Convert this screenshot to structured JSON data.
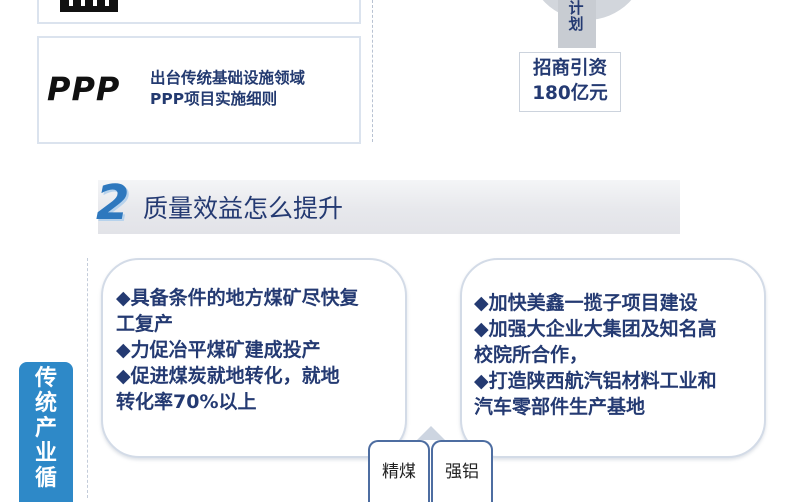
{
  "policy": {
    "ppp_logo": "PPP",
    "ppp_line1": "出台传统基础设施领域",
    "ppp_line2": "PPP项目实施细则"
  },
  "investment": {
    "plan_label": "计划",
    "title_line1": "招商引资",
    "title_line2": "180亿元"
  },
  "section": {
    "number": "2",
    "title": "质量效益怎么提升"
  },
  "side_label": "传统产业循",
  "left_card": {
    "lines": [
      "◆具备条件的地方煤矿尽快复",
      "工复产",
      "◆力促冶平煤矿建成投产",
      "◆促进煤炭就地转化，就地",
      "转化率70%以上"
    ]
  },
  "right_card": {
    "lines": [
      "◆加快美鑫一揽子项目建设",
      "◆加强大企业大集团及知名高",
      "校院所合作，",
      "◆打造陕西航汽铝材料工业和",
      "汽车零部件生产基地"
    ]
  },
  "bottom_labels": [
    "精煤",
    "强铝"
  ],
  "colors": {
    "text_navy": "#243a72",
    "accent_blue": "#2e78be",
    "side_tab_blue": "#2e89c8",
    "border_light": "#d3dbe7"
  }
}
